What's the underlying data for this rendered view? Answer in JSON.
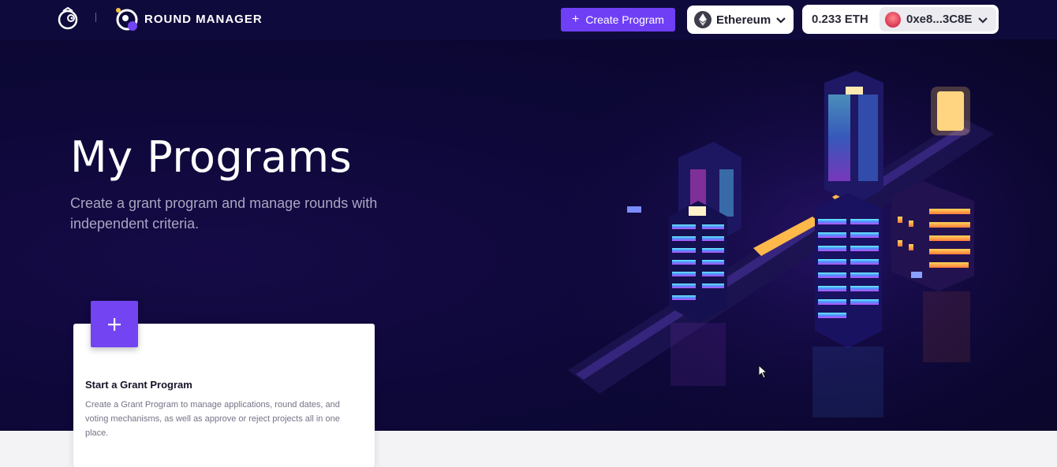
{
  "header": {
    "app_title": "ROUND MANAGER",
    "create_button_label": "Create Program",
    "network_label": "Ethereum",
    "balance": "0.233 ETH",
    "wallet_address": "0xe8...3C8E"
  },
  "hero": {
    "title": "My Programs",
    "subtitle": "Create a grant program and manage rounds with independent criteria."
  },
  "card": {
    "title": "Start a Grant Program",
    "description": "Create a Grant Program to manage applications, round dates, and voting mechanisms, as well as approve or reject projects all in one place."
  },
  "colors": {
    "accent": "#6f3ff5",
    "hero_background": "#0d0838",
    "card_plus": "#7344f2"
  },
  "icons": [
    "gitcoin-logo-icon",
    "round-manager-logo-icon",
    "plus-icon",
    "ethereum-icon",
    "chevron-down-icon",
    "wallet-avatar-icon",
    "mouse-cursor-icon"
  ]
}
